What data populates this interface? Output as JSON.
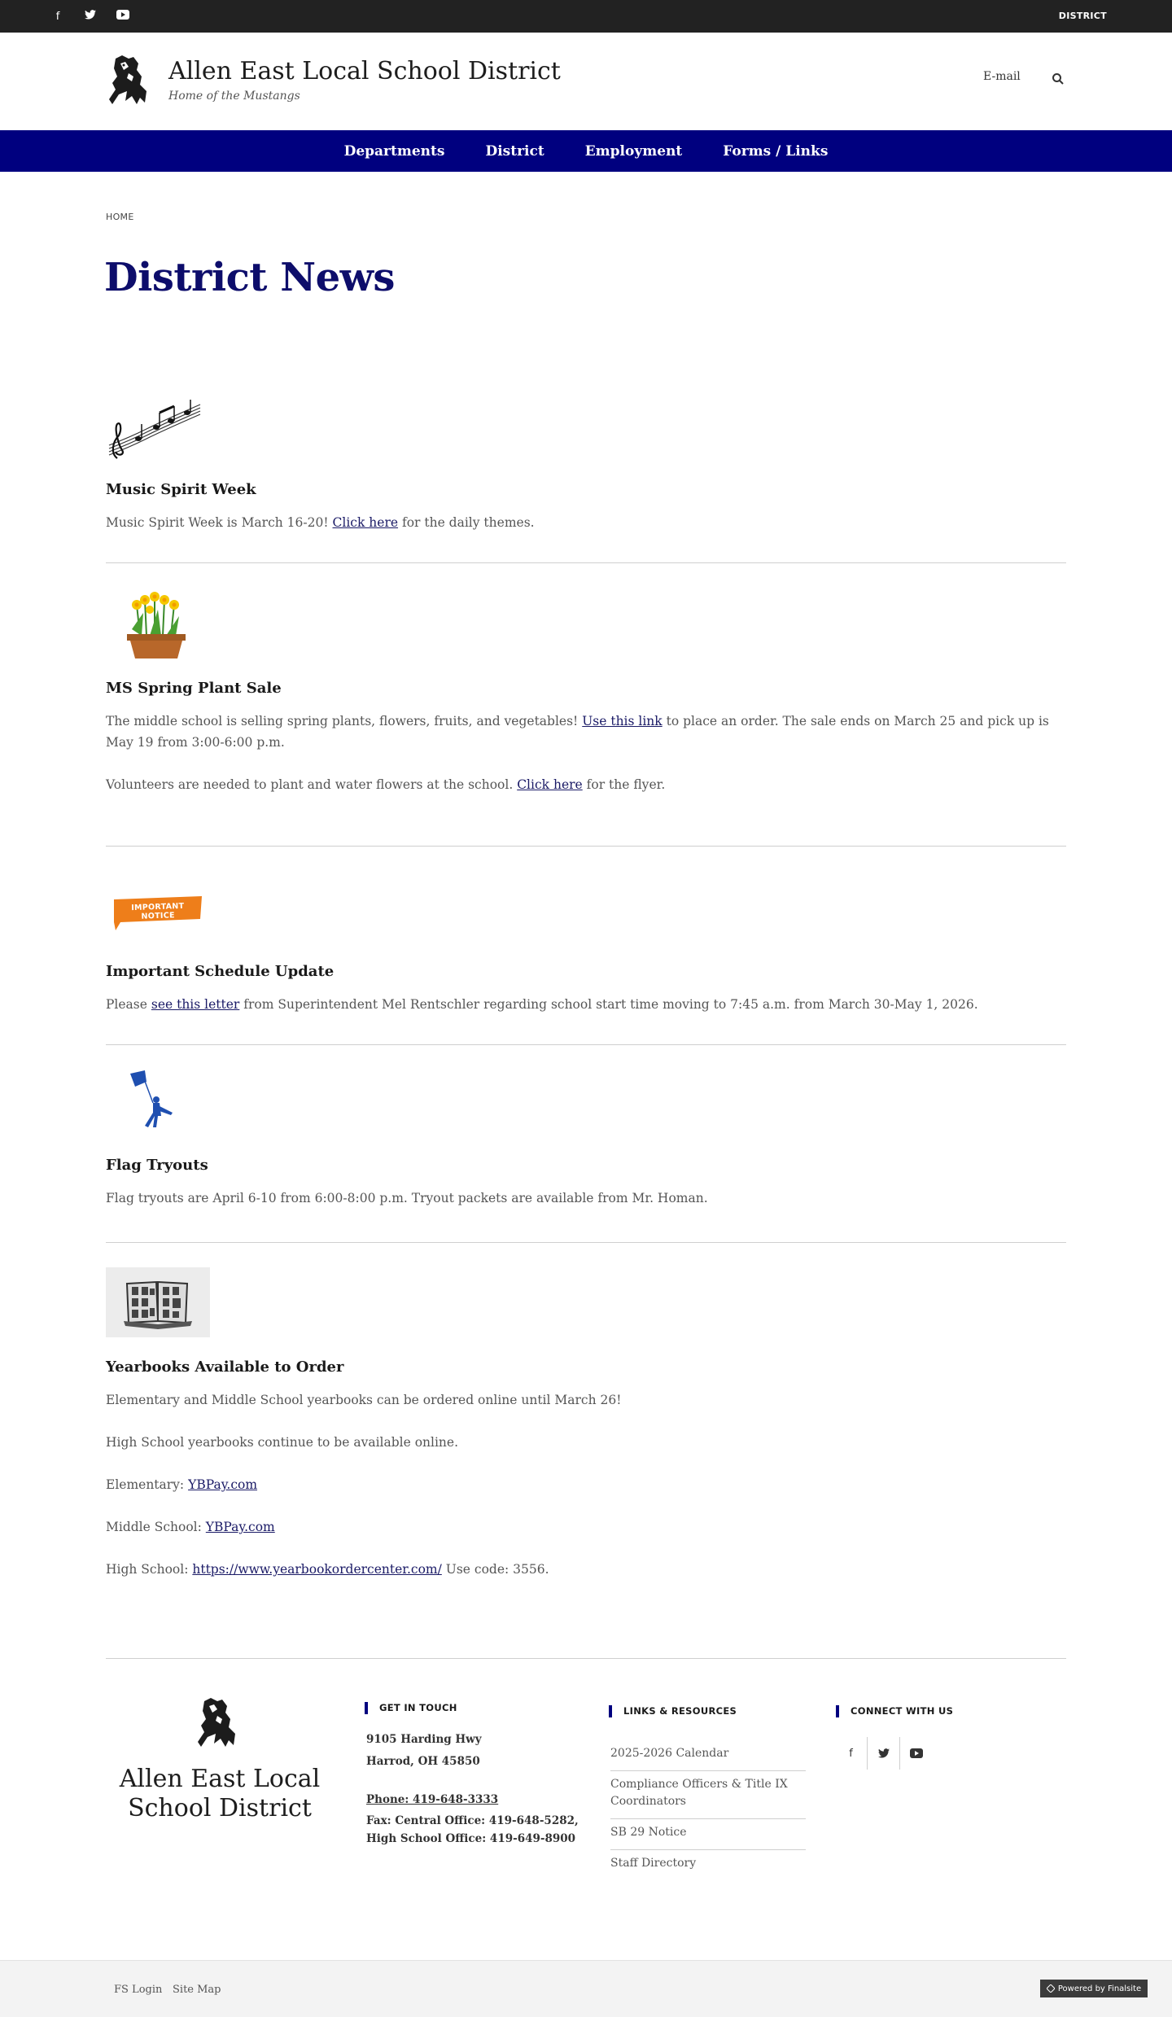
{
  "topbar": {
    "social": [
      {
        "name": "facebook-icon",
        "glyph": "f"
      },
      {
        "name": "twitter-icon",
        "glyph": "🐦"
      },
      {
        "name": "youtube-icon",
        "glyph": "▶"
      }
    ],
    "district_label": "DISTRICT"
  },
  "header": {
    "title": "Allen East Local School District",
    "tagline": "Home of the Mustangs",
    "email_label": "E-mail"
  },
  "nav": [
    "Departments",
    "District",
    "Employment",
    "Forms / Links"
  ],
  "breadcrumb": "HOME",
  "page_title": "District News",
  "news": [
    {
      "title": "Music Spirit Week",
      "paragraphs": [
        [
          {
            "t": "Music Spirit Week is March 16-20!  "
          },
          {
            "t": "Click here",
            "link": true
          },
          {
            "t": " for the daily themes."
          }
        ]
      ]
    },
    {
      "title": "MS Spring Plant Sale",
      "paragraphs": [
        [
          {
            "t": "The middle school is selling spring plants, flowers, fruits, and vegetables! "
          },
          {
            "t": "Use this link",
            "link": true
          },
          {
            "t": " to place an order.  The sale ends on March 25 and pick up is May 19 from 3:00-6:00 p.m."
          }
        ],
        [
          {
            "t": "Volunteers are needed to plant and water flowers at the school.  "
          },
          {
            "t": "Click here",
            "link": true
          },
          {
            "t": " for the flyer."
          }
        ]
      ]
    },
    {
      "title": "Important Schedule Update",
      "badge": "IMPORTANT NOTICE",
      "paragraphs": [
        [
          {
            "t": "Please "
          },
          {
            "t": "see this letter",
            "link": true
          },
          {
            "t": " from Superintendent Mel Rentschler regarding school start time moving to 7:45 a.m. from March 30-May 1, 2026."
          }
        ]
      ]
    },
    {
      "title": "Flag Tryouts",
      "paragraphs": [
        [
          {
            "t": "Flag tryouts are April 6-10 from 6:00-8:00 p.m.  Tryout packets are available from Mr. Homan."
          }
        ]
      ]
    },
    {
      "title": "Yearbooks Available to Order",
      "paragraphs": [
        [
          {
            "t": "Elementary and Middle School yearbooks can be ordered online until March 26!"
          }
        ],
        [
          {
            "t": "High School yearbooks continue to be available online."
          }
        ],
        [
          {
            "t": "Elementary: "
          },
          {
            "t": "YBPay.com",
            "link": true
          }
        ],
        [
          {
            "t": "Middle School: "
          },
          {
            "t": "YBPay.com",
            "link": true
          }
        ],
        [
          {
            "t": "High School: "
          },
          {
            "t": "https://www.yearbookordercenter.com/",
            "link": true
          },
          {
            "t": " Use code: 3556."
          }
        ]
      ]
    }
  ],
  "footer": {
    "name": "Allen East Local School District",
    "get_in_touch_heading": "GET IN TOUCH",
    "address_line1": "9105 Harding Hwy",
    "address_line2": "Harrod, OH  45850",
    "phone": "Phone: 419-648-3333",
    "fax": "Fax: Central Office: 419-648-5282, High School Office: 419-649-8900",
    "links_heading": "LINKS & RESOURCES",
    "links": [
      "2025-2026 Calendar",
      "Compliance Officers & Title IX Coordinators",
      "SB 29 Notice",
      "Staff Directory"
    ],
    "connect_heading": "CONNECT WITH US",
    "social": [
      {
        "name": "facebook-icon",
        "glyph": "f"
      },
      {
        "name": "twitter-icon",
        "glyph": "🐦"
      },
      {
        "name": "youtube-icon",
        "glyph": "▶"
      }
    ]
  },
  "bottom": {
    "fs_login": "FS Login",
    "site_map": "Site Map",
    "powered": "Powered by Finalsite"
  },
  "colors": {
    "nav_bg": "#00007f",
    "title": "#0d0d6b",
    "topbar": "#222222"
  }
}
